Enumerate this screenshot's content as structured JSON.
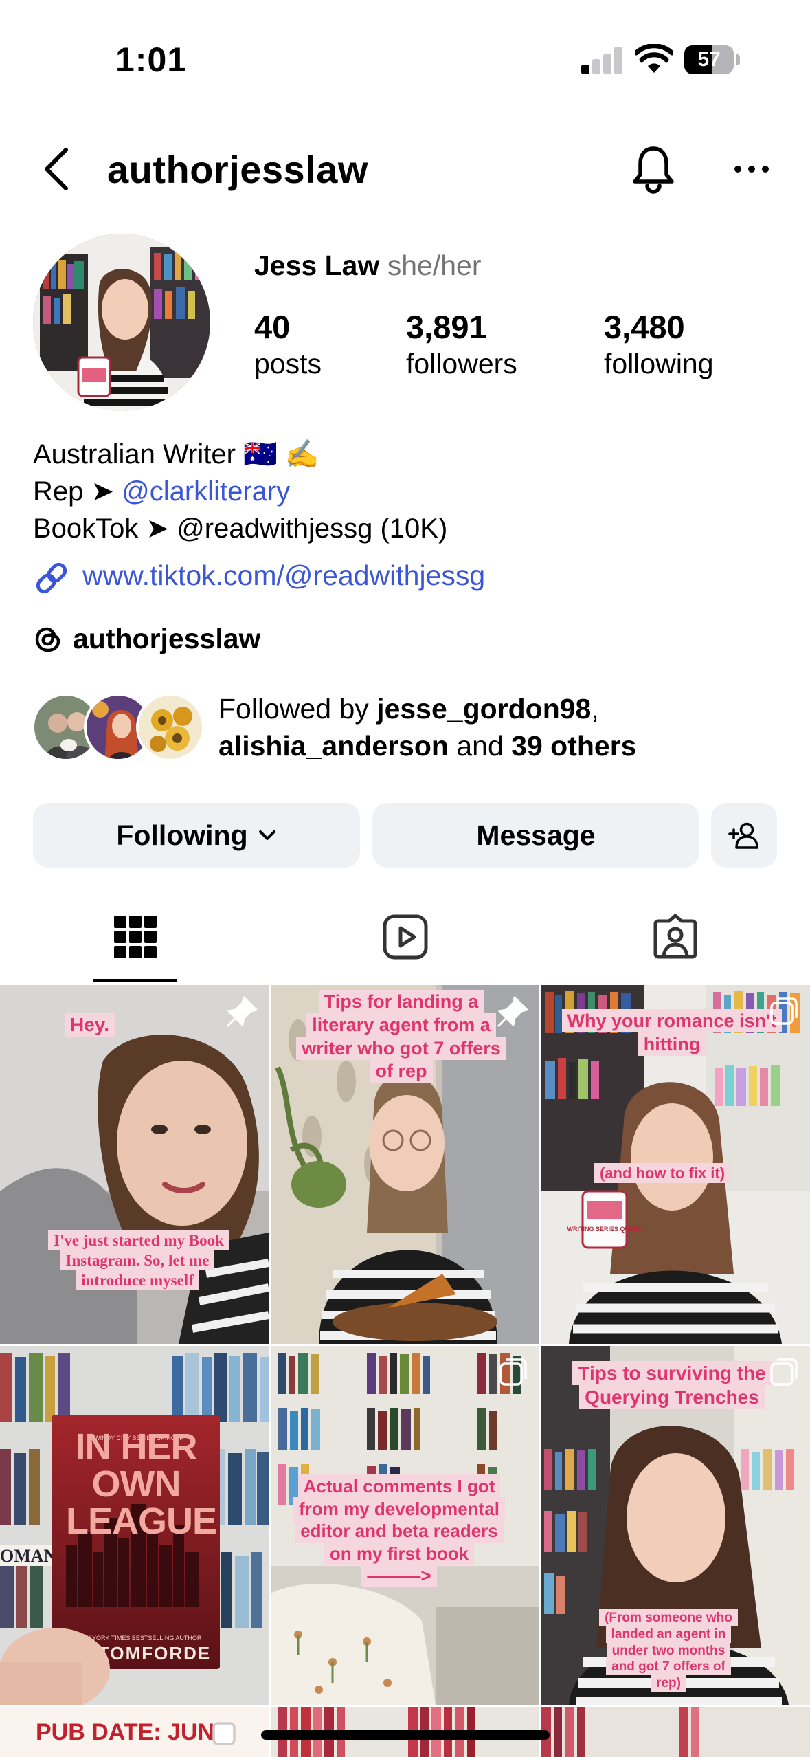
{
  "status_bar": {
    "time": "1:01",
    "battery": "57"
  },
  "header": {
    "title": "authorjesslaw"
  },
  "profile": {
    "name": "Jess Law",
    "pronouns": "she/her",
    "stats": [
      {
        "value": "40",
        "label": "posts"
      },
      {
        "value": "3,891",
        "label": "followers"
      },
      {
        "value": "3,480",
        "label": "following"
      }
    ],
    "bio": {
      "line1": "Australian Writer 🇦🇺 ✍️",
      "line2_prefix": "Rep ➤ ",
      "line2_mention": "@clarkliterary",
      "line3": "BookTok ➤ @readwithjessg (10K)"
    },
    "link": "www.tiktok.com/@readwithjessg",
    "threads": "authorjesslaw",
    "followed_by": {
      "prefix": "Followed by ",
      "user1": "jesse_gordon98",
      "sep": ",",
      "user2": "alishia_anderson",
      "mid": " and ",
      "others": "39 others"
    }
  },
  "buttons": {
    "following": "Following",
    "message": "Message"
  },
  "posts": [
    {
      "top": "Hey.",
      "bottom": "I've just started my Book Instagram. So, let me introduce myself"
    },
    {
      "top": "Tips for landing a literary agent from a writer who got 7 offers of rep"
    },
    {
      "top": "Why your romance isn't hitting",
      "bottom": "(and how to fix it)",
      "mug": "WRITING SERIES QUEEN"
    },
    {
      "book_title": "IN HER OWN LEAGUE",
      "book_series": "A WINDY CITY SERIES SPINOFF",
      "book_blurb": "A NEW YORK TIMES BESTSELLING AUTHOR",
      "book_author": "LIZ TOMFORDE",
      "side_word": "OMAN"
    },
    {
      "middle": "Actual comments I got from my developmental editor and beta readers on my first book",
      "arrow": "———>"
    },
    {
      "top": "Tips to surviving the Querying Trenches",
      "bottom": "(From someone who landed an agent in under two months and got 7 offers of rep)"
    },
    {
      "top": "PUB DATE: JUN"
    }
  ],
  "colors": {
    "link": "#3b55d9",
    "button_bg": "#eff2f5",
    "caption_pink": "#e0356c"
  }
}
